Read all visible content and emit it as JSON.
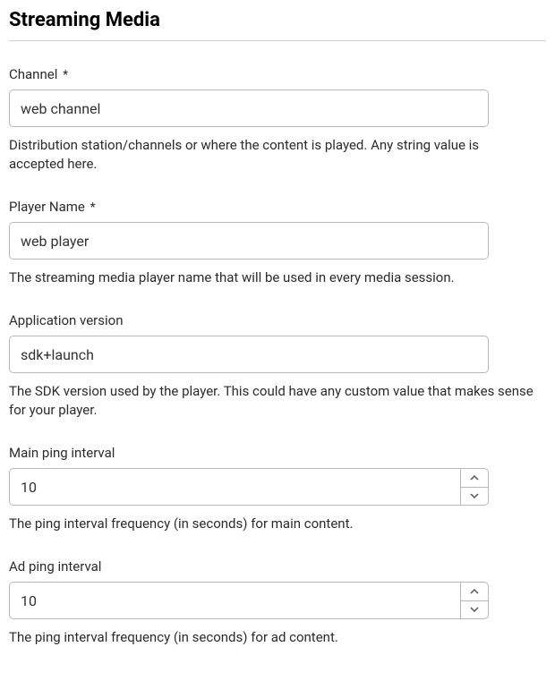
{
  "section": {
    "title": "Streaming Media"
  },
  "fields": {
    "channel": {
      "label": "Channel",
      "required_mark": "*",
      "value": "web channel",
      "help": "Distribution station/channels or where the content is played. Any string value is accepted here."
    },
    "player_name": {
      "label": "Player Name",
      "required_mark": "*",
      "value": "web player",
      "help": "The streaming media player name that will be used in every media session."
    },
    "app_version": {
      "label": "Application version",
      "value": "sdk+launch",
      "help": "The SDK version used by the player. This could have any custom value that makes sense for your player."
    },
    "main_ping": {
      "label": "Main ping interval",
      "value": "10",
      "help": "The ping interval frequency (in seconds) for main content."
    },
    "ad_ping": {
      "label": "Ad ping interval",
      "value": "10",
      "help": "The ping interval frequency (in seconds) for ad content."
    }
  }
}
